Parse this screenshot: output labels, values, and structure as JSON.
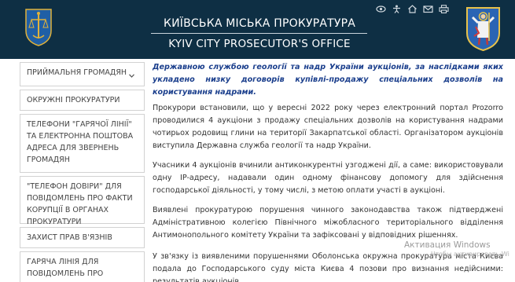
{
  "header": {
    "title_ua": "КИЇВСЬКА МІСЬКА ПРОКУРАТУРА",
    "title_en": "KYIV CITY PROSECUTOR'S OFFICE",
    "left_emblem": "prosecutor-emblem-icon",
    "right_emblem": "kyiv-coat-of-arms-icon",
    "utility_icons": [
      "eye-icon",
      "accessibility-icon",
      "home-icon",
      "mail-icon",
      "print-icon"
    ]
  },
  "sidebar": {
    "items": [
      {
        "label": "ПРИЙМАЛЬНЯ ГРОМАДЯН",
        "chevron": "chevron-down-icon"
      },
      {
        "label": "ОКРУЖНІ ПРОКУРАТУРИ"
      },
      {
        "label": "ТЕЛЕФОНИ \"ГАРЯЧОЇ ЛІНІЇ\" ТА ЕЛЕКТРОННА ПОШТОВА АДРЕСА ДЛЯ ЗВЕРНЕНЬ ГРОМАДЯН"
      },
      {
        "label": "\"ТЕЛЕФОН ДОВІРИ\" ДЛЯ ПОВІДОМЛЕНЬ ПРО ФАКТИ КОРУПЦІЇ В ОРГАНАХ ПРОКУРАТУРИ"
      },
      {
        "label": "ЗАХИСТ ПРАВ В'ЯЗНІВ"
      },
      {
        "label": "ГАРЯЧА ЛІНІЯ ДЛЯ ПОВІДОМЛЕНЬ ПРО"
      }
    ]
  },
  "article": {
    "lead": "Державною службою геології та надр України аукціонів, за наслідками яких укладено низку договорів купівлі-продажу спеціальних дозволів на користування надрами.",
    "paragraphs": [
      "Прокурори встановили, що у вересні 2022 року через електронний портал Prozorro проводилися 4 аукціони з продажу спеціальних дозволів на користування надрами чотирьох родовищ глини на території Закарпатської області. Організатором аукціонів виступила Державна служба геології та надр України.",
      "Учасники 4 аукціонів вчинили антиконкурентні узгоджені дії, а саме: використовували одну IP-адресу, надавали один одному фінансову допомогу для здійснення господарської діяльності, у тому числі, з метою оплати участі в аукціоні.",
      "Виявлені прокуратурою порушення чинного законодавства також підтверджені Адміністративною колегією Північного міжобласного територіального відділення Антимонопольного комітету України та зафіксовані у відповідних рішеннях.",
      "У зв'язку із виявленими порушеннями Оболонська окружна прокуратура міста Києва подала до Господарського суду міста Києва 4 позови про визнання недійсними: результатів аукціонів,"
    ]
  },
  "watermark": {
    "title": "Активация Windows",
    "subtitle": "Чтобы активировать Windows, перейдите в раздел «Параметры»."
  }
}
